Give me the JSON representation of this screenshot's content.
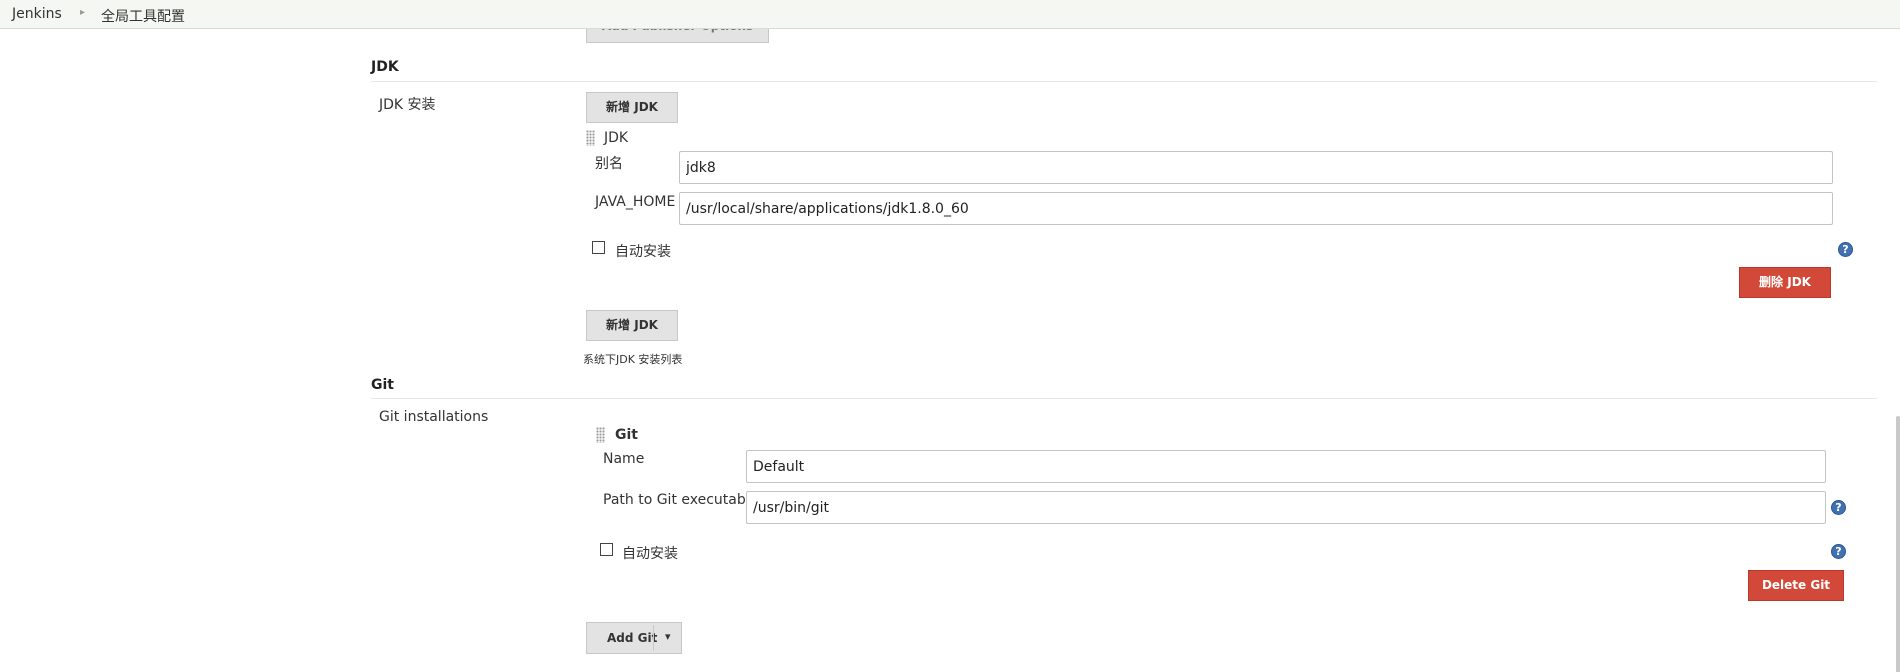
{
  "breadcrumb": {
    "items": [
      "Jenkins",
      "全局工具配置"
    ],
    "separator": "▸"
  },
  "partial_button": {
    "label": "Add Publisher Options"
  },
  "jdk_section": {
    "title": "JDK",
    "install_label": "JDK 安装",
    "add_button_label": "新增 JDK",
    "entry_title": "JDK",
    "alias_label": "别名",
    "alias_value": "jdk8",
    "java_home_label": "JAVA_HOME",
    "java_home_value": "/usr/local/share/applications/jdk1.8.0_60",
    "auto_install_label": "自动安装",
    "delete_button_label": "删除 JDK",
    "add_button_label_2": "新增 JDK",
    "list_caption": "系统下JDK 安装列表"
  },
  "git_section": {
    "title": "Git",
    "installations_label": "Git installations",
    "entry_title": "Git",
    "name_label": "Name",
    "name_value": "Default",
    "path_label": "Path to Git executable",
    "path_value": "/usr/bin/git",
    "auto_install_label": "自动安装",
    "delete_button_label": "Delete Git",
    "add_button_label": "Add Git"
  },
  "icons": {
    "help": "?",
    "dropdown": "▾"
  },
  "colors": {
    "delete_button": "#d24939",
    "help_icon": "#3f71b3",
    "breadcrumb_bg": "#f5f8f2"
  }
}
